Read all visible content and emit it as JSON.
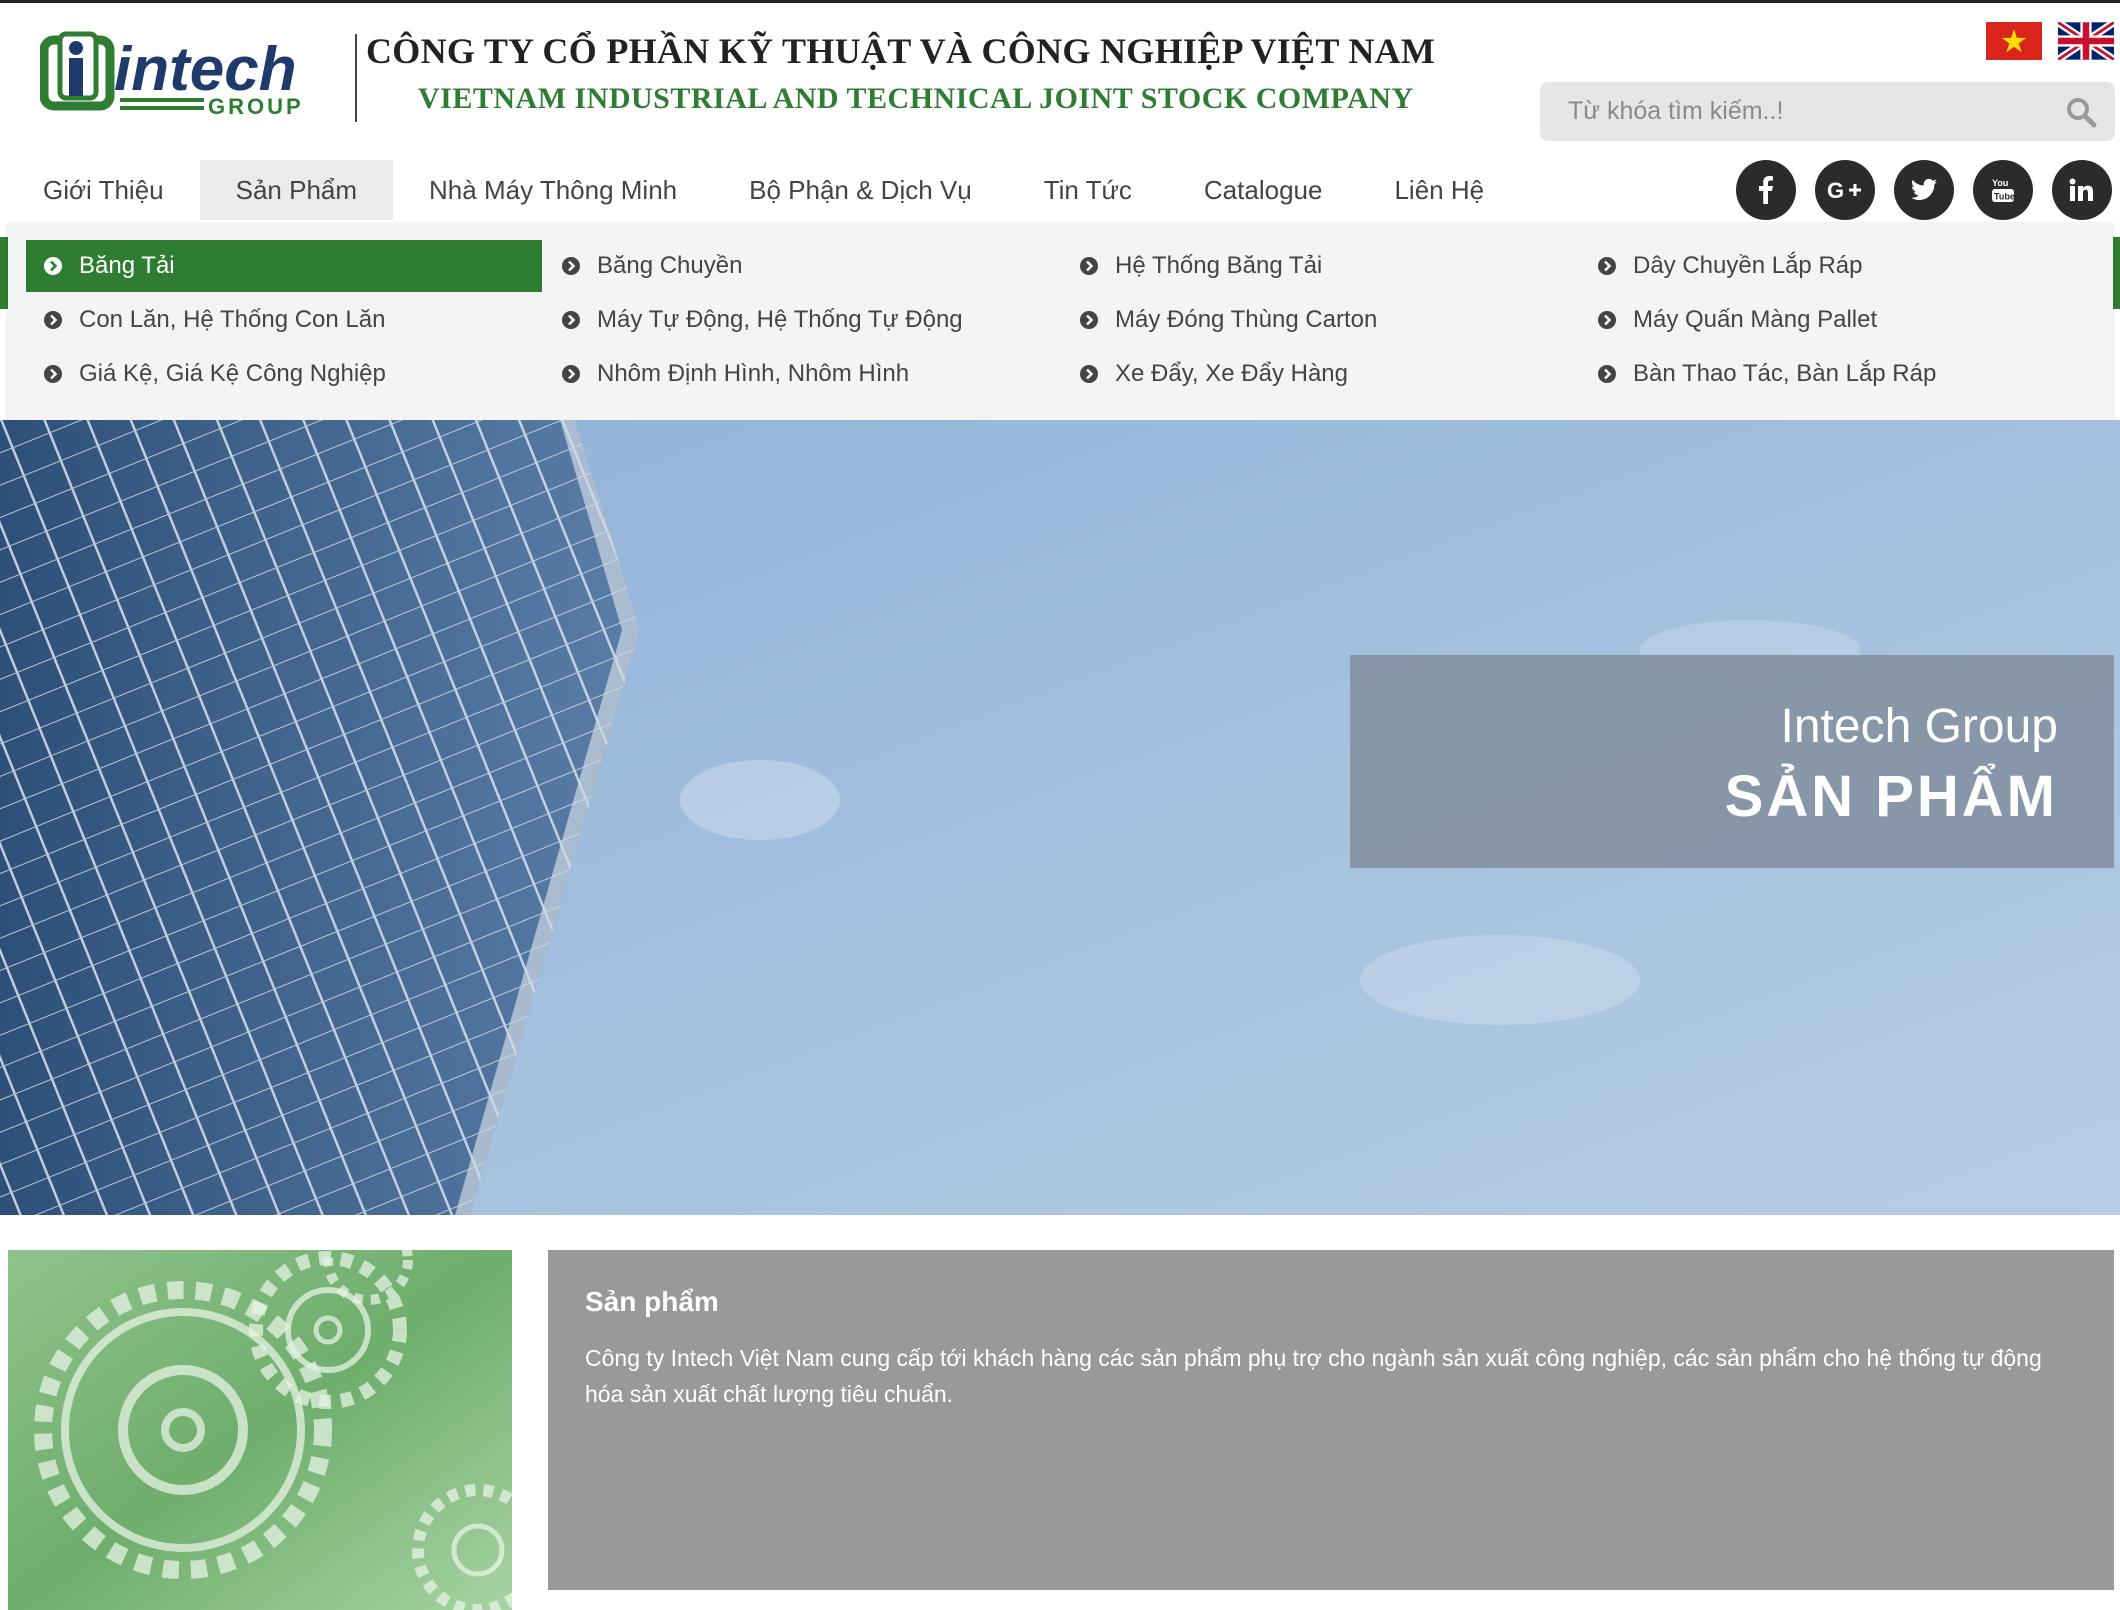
{
  "header": {
    "logo_text": "intech",
    "logo_sub": "GROUP",
    "company_name_vn": "CÔNG TY CỔ PHẦN KỸ THUẬT VÀ CÔNG NGHIỆP VIỆT NAM",
    "company_name_en": "VIETNAM  INDUSTRIAL  AND TECHNICAL  JOINT STOCK COMPANY",
    "languages": [
      {
        "icon": "vietnam-flag-icon"
      },
      {
        "icon": "uk-flag-icon"
      }
    ]
  },
  "search": {
    "placeholder": "Từ khóa tìm kiếm..!",
    "value": "",
    "icon": "search-icon"
  },
  "nav": {
    "items": [
      {
        "label": "Giới Thiệu"
      },
      {
        "label": "Sản Phẩm",
        "active": true
      },
      {
        "label": "Nhà Máy Thông Minh"
      },
      {
        "label": "Bộ Phận & Dịch Vụ"
      },
      {
        "label": "Tin Tức"
      },
      {
        "label": "Catalogue"
      },
      {
        "label": "Liên Hệ"
      }
    ]
  },
  "social": [
    "facebook-icon",
    "google-plus-icon",
    "twitter-icon",
    "youtube-icon",
    "linkedin-icon"
  ],
  "dropdown": {
    "items": [
      {
        "label": "Băng Tải",
        "active": true
      },
      {
        "label": "Băng Chuyền"
      },
      {
        "label": "Hệ Thống Băng Tải"
      },
      {
        "label": "Dây Chuyền Lắp Ráp"
      },
      {
        "label": "Con Lăn, Hệ Thống Con Lăn"
      },
      {
        "label": "Máy Tự Động, Hệ Thống Tự Động"
      },
      {
        "label": "Máy Đóng Thùng Carton"
      },
      {
        "label": "Máy Quấn Màng Pallet"
      },
      {
        "label": "Giá Kệ, Giá Kệ Công Nghiệp"
      },
      {
        "label": "Nhôm Định Hình, Nhôm Hình"
      },
      {
        "label": "Xe Đẩy, Xe Đẩy Hàng"
      },
      {
        "label": "Bàn Thao Tác, Bàn Lắp Ráp"
      }
    ]
  },
  "hero": {
    "subtitle": "Intech Group",
    "title": "SẢN PHẨM"
  },
  "info": {
    "title": "Sản phẩm",
    "text": "Công ty Intech Việt Nam cung cấp tới khách hàng các sản phẩm phụ trợ cho ngành sản xuất công nghiệp, các sản phẩm cho hệ thống tự động hóa sản xuất chất lượng tiêu chuẩn."
  },
  "colors": {
    "brand_green": "#2e7d32",
    "nav_text": "#444444",
    "social_bg": "#2b2b2b",
    "info_bg": "#999999"
  }
}
